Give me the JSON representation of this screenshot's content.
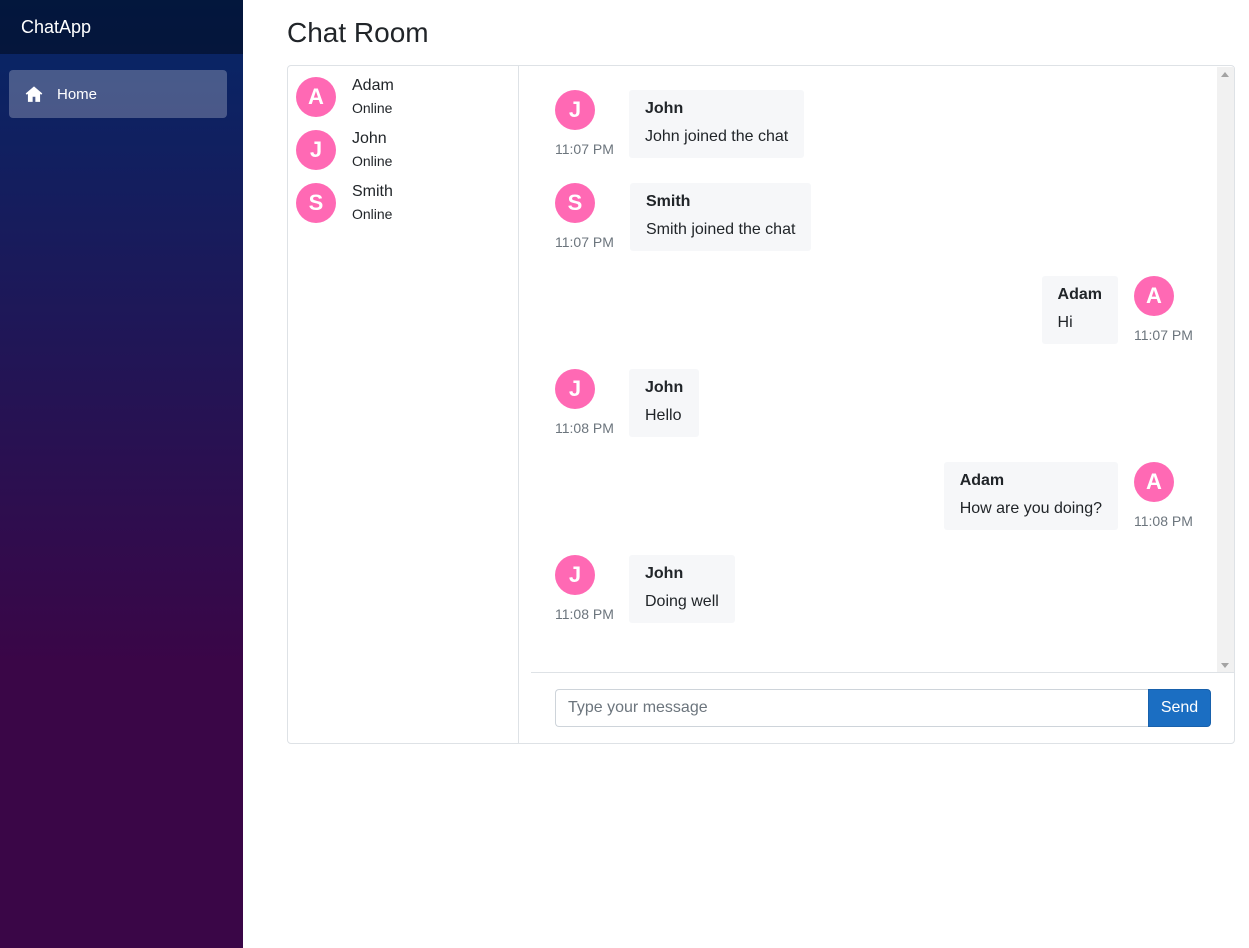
{
  "sidebar": {
    "brand": "ChatApp",
    "nav": [
      {
        "label": "Home",
        "icon": "home-icon"
      }
    ]
  },
  "page": {
    "title": "Chat Room"
  },
  "users": [
    {
      "initial": "A",
      "name": "Adam",
      "status": "Online"
    },
    {
      "initial": "J",
      "name": "John",
      "status": "Online"
    },
    {
      "initial": "S",
      "name": "Smith",
      "status": "Online"
    }
  ],
  "messages": [
    {
      "initial": "J",
      "sender": "John",
      "text": "John joined the chat",
      "time": "11:07 PM",
      "side": "left"
    },
    {
      "initial": "S",
      "sender": "Smith",
      "text": "Smith joined the chat",
      "time": "11:07 PM",
      "side": "left"
    },
    {
      "initial": "A",
      "sender": "Adam",
      "text": "Hi",
      "time": "11:07 PM",
      "side": "right"
    },
    {
      "initial": "J",
      "sender": "John",
      "text": "Hello",
      "time": "11:08 PM",
      "side": "left"
    },
    {
      "initial": "A",
      "sender": "Adam",
      "text": "How are you doing?",
      "time": "11:08 PM",
      "side": "right"
    },
    {
      "initial": "J",
      "sender": "John",
      "text": "Doing well",
      "time": "11:08 PM",
      "side": "left"
    }
  ],
  "composer": {
    "placeholder": "Type your message",
    "value": "",
    "send_label": "Send"
  },
  "colors": {
    "avatar": "#ff69b4",
    "accent": "#1b6ec2",
    "bubble": "#f6f7f9"
  }
}
